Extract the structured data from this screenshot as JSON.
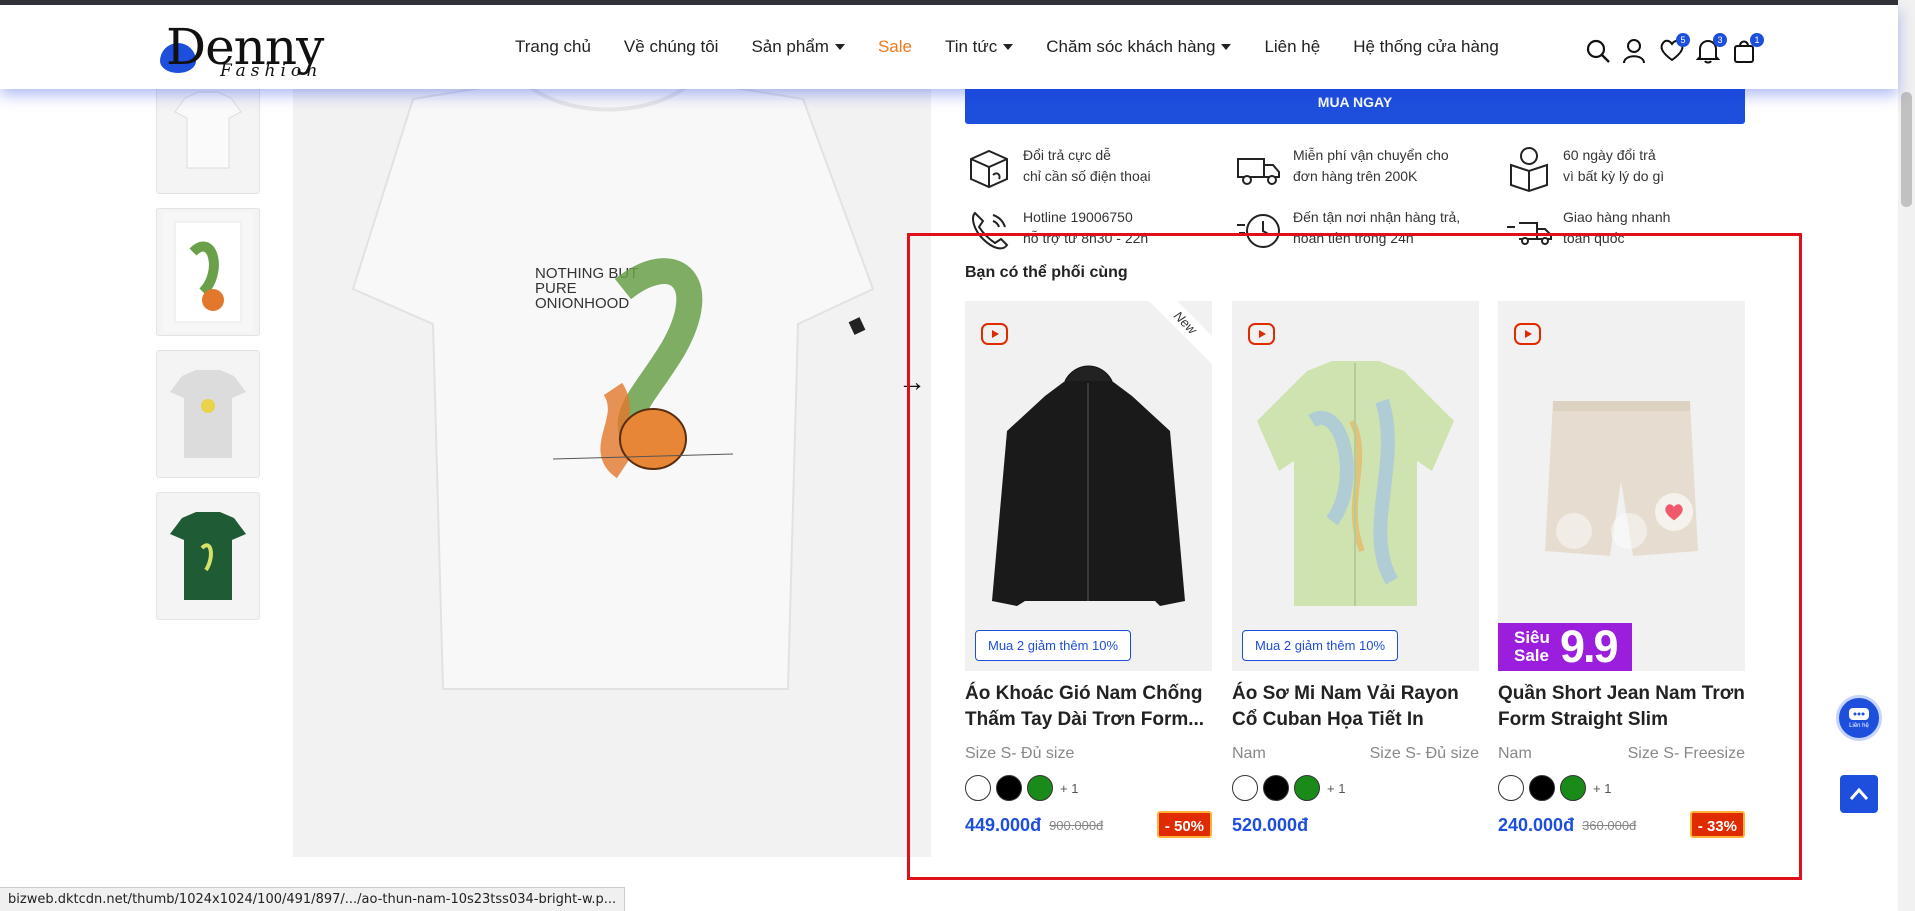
{
  "header": {
    "logo_text": "Denny",
    "logo_sub": "Fashion",
    "nav": [
      {
        "label": "Trang chủ",
        "caret": false
      },
      {
        "label": "Về chúng tôi",
        "caret": false
      },
      {
        "label": "Sản phẩm",
        "caret": true
      },
      {
        "label": "Sale",
        "caret": false
      },
      {
        "label": "Tin tức",
        "caret": true
      },
      {
        "label": "Chăm sóc khách hàng",
        "caret": true
      },
      {
        "label": "Liên hệ",
        "caret": false
      },
      {
        "label": "Hệ thống cửa hàng",
        "caret": false
      }
    ],
    "badges": {
      "wishlist": "5",
      "notifications": "3",
      "cart": "1"
    }
  },
  "buy_now": "MUA NGAY",
  "features": [
    {
      "line1": "Đổi trả cực dễ",
      "line2": "chỉ cần số điện thoại",
      "icon": "box-return-icon"
    },
    {
      "line1": "Miễn phí vận chuyển cho",
      "line2": "đơn hàng trên 200K",
      "icon": "truck-icon"
    },
    {
      "line1": "60 ngày đổi trả",
      "line2": "vì bất kỳ lý do gì",
      "icon": "open-box-icon"
    },
    {
      "line1": "Hotline 19006750",
      "line2": "hỗ trợ từ 8h30 - 22h",
      "icon": "phone-icon"
    },
    {
      "line1": "Đến tận nơi nhận hàng trả,",
      "line2": "hoàn tiền trong 24h",
      "icon": "fast-clock-icon"
    },
    {
      "line1": "Giao hàng nhanh",
      "line2": "toàn quốc",
      "icon": "fast-truck-icon"
    }
  ],
  "section_title": "Bạn có thể phối cùng",
  "products": [
    {
      "name": "Áo Khoác Gió Nam Chống Thấm Tay Dài Trơn Form...",
      "meta_left": "Size S- Đủ size",
      "meta_right": "",
      "price": "449.000đ",
      "old_price": "900.000đ",
      "discount": "- 50%",
      "promo": "Mua 2 giảm thêm 10%",
      "new_tag": "New",
      "swatch_more": "+ 1"
    },
    {
      "name": "Áo Sơ Mi Nam Vải Rayon Cổ Cuban Họa Tiết In Form...",
      "meta_left": "Nam",
      "meta_right": "Size S- Đủ size",
      "price": "520.000đ",
      "old_price": "",
      "discount": "",
      "promo": "Mua 2 giảm thêm 10%",
      "new_tag": "",
      "swatch_more": "+ 1"
    },
    {
      "name": "Quần Short Jean Nam Trơn Form Straight Slim",
      "meta_left": "Nam",
      "meta_right": "Size S- Freesize",
      "price": "240.000đ",
      "old_price": "360.000đ",
      "discount": "- 33%",
      "sale_label_line1": "Siêu",
      "sale_label_line2": "Sale",
      "sale_number": "9.9",
      "swatch_more": "+ 1"
    }
  ],
  "swatch_colors": [
    "#ffffff",
    "#000000",
    "#1a8a1a"
  ],
  "chat_label": "Liên hệ",
  "status_url": "bizweb.dktcdn.net/thumb/1024x1024/100/491/897/.../ao-thun-nam-10s23tss034-bright-w.p...",
  "colors": {
    "accent": "#1e4fdc",
    "sale": "#f07b1d",
    "highlight_box": "#e0101a",
    "discount": "#e02a00",
    "super_sale": "#9b1edc"
  }
}
